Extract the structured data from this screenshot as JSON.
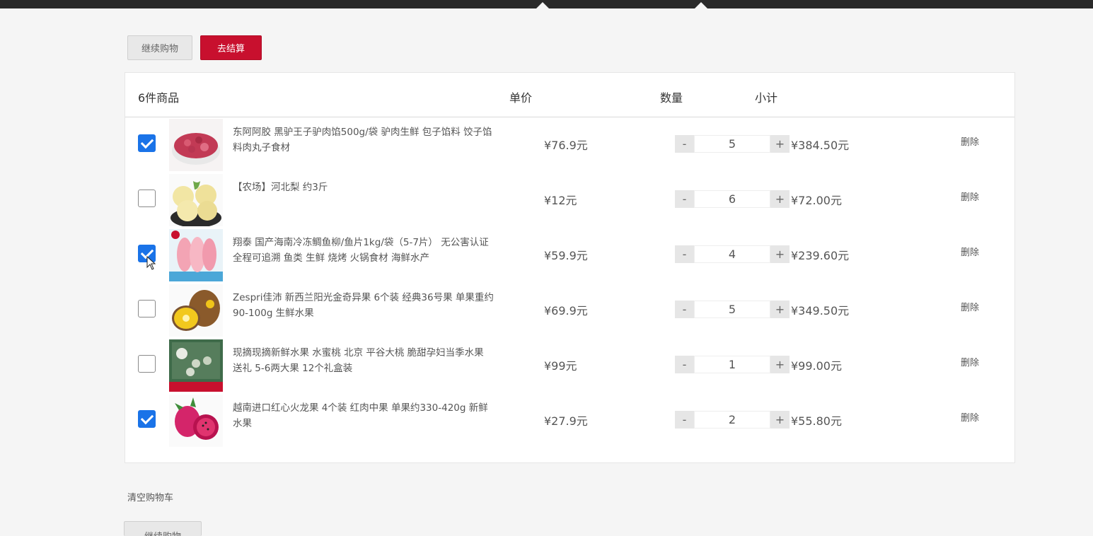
{
  "toolbar": {
    "continue_label": "继续购物",
    "checkout_label": "去结算"
  },
  "table": {
    "header": {
      "count_label": "6件商品",
      "price_label": "单价",
      "qty_label": "数量",
      "subtotal_label": "小计"
    },
    "items": [
      {
        "checked": true,
        "thumb_icon": "minced-meat-icon",
        "name": "东阿阿胶 黑驴王子驴肉馅500g/袋 驴肉生鲜 包子馅料 饺子馅料肉丸子食材",
        "price": "¥76.9元",
        "qty": "5",
        "subtotal": "¥384.50元",
        "delete": "删除"
      },
      {
        "checked": false,
        "thumb_icon": "pear-icon",
        "name": "【农场】河北梨 约3斤",
        "price": "¥12元",
        "qty": "6",
        "subtotal": "¥72.00元",
        "delete": "删除"
      },
      {
        "checked": true,
        "thumb_icon": "fish-fillet-icon",
        "name": "翔泰 国产海南冷冻鲷鱼柳/鱼片1kg/袋（5-7片） 无公害认证 全程可追溯 鱼类 生鲜 烧烤 火锅食材 海鲜水产",
        "price": "¥59.9元",
        "qty": "4",
        "subtotal": "¥239.60元",
        "delete": "删除"
      },
      {
        "checked": false,
        "thumb_icon": "kiwi-icon",
        "name": "Zespri佳沛 新西兰阳光金奇异果 6个装 经典36号果 单果重约90-100g 生鲜水果",
        "price": "¥69.9元",
        "qty": "5",
        "subtotal": "¥349.50元",
        "delete": "删除"
      },
      {
        "checked": false,
        "thumb_icon": "peach-box-icon",
        "name": "现摘现摘新鲜水果 水蜜桃 北京 平谷大桃 脆甜孕妇当季水果 送礼 5-6两大果 12个礼盒装",
        "price": "¥99元",
        "qty": "1",
        "subtotal": "¥99.00元",
        "delete": "删除"
      },
      {
        "checked": true,
        "thumb_icon": "dragon-fruit-icon",
        "name": "越南进口红心火龙果 4个装 红肉中果 单果约330-420g 新鲜水果",
        "price": "¥27.9元",
        "qty": "2",
        "subtotal": "¥55.80元",
        "delete": "删除"
      }
    ],
    "minus_label": "-",
    "plus_label": "+"
  },
  "footer": {
    "clear_label": "清空购物车",
    "continue_label": "继续购物"
  },
  "colors": {
    "accent": "#c8102e",
    "checkbox": "#1a73e8"
  }
}
